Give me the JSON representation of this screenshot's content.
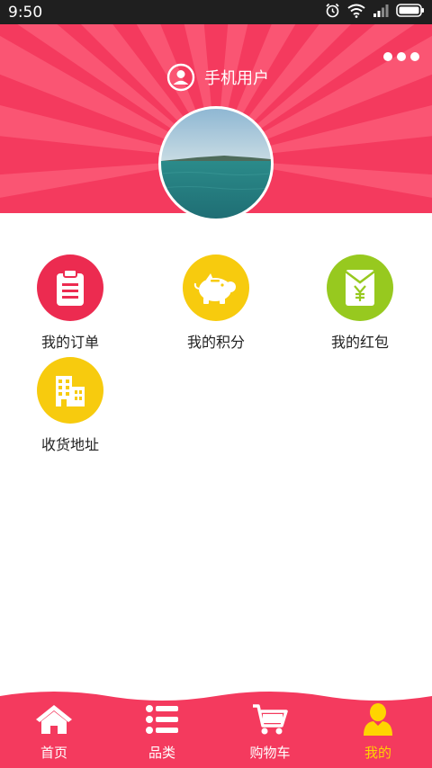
{
  "status_bar": {
    "time": "9:50",
    "icons": [
      "alarm-icon",
      "wifi-icon",
      "signal-icon",
      "battery-icon"
    ]
  },
  "header": {
    "user_name": "手机用户",
    "more_icon": "more-dots-icon",
    "avatar_icon": "avatar-photo"
  },
  "menu": {
    "items": [
      {
        "label": "我的订单",
        "icon": "clipboard-icon",
        "color": "#ec2b50"
      },
      {
        "label": "我的积分",
        "icon": "piggy-bank-icon",
        "color": "#f7cb0e"
      },
      {
        "label": "我的红包",
        "icon": "red-envelope-icon",
        "color": "#97c91f"
      },
      {
        "label": "收货地址",
        "icon": "building-icon",
        "color": "#f7cb0e"
      }
    ]
  },
  "tab_bar": {
    "tabs": [
      {
        "label": "首页",
        "icon": "home-icon",
        "active": false
      },
      {
        "label": "品类",
        "icon": "list-icon",
        "active": false
      },
      {
        "label": "购物车",
        "icon": "cart-icon",
        "active": false
      },
      {
        "label": "我的",
        "icon": "person-icon",
        "active": true
      }
    ],
    "colors": {
      "background": "#f43a5e",
      "active": "#ffd400",
      "inactive": "#ffffff"
    }
  }
}
